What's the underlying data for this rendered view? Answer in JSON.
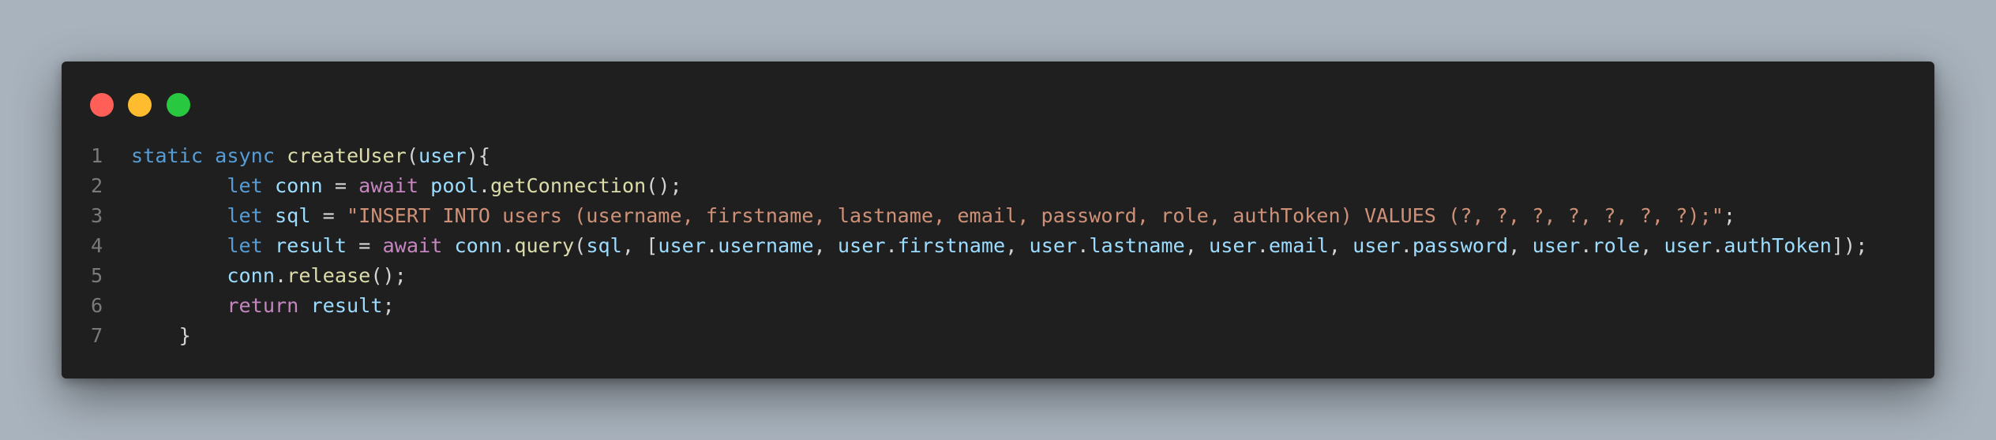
{
  "window": {
    "controls": [
      "close",
      "minimize",
      "maximize"
    ],
    "colors": {
      "close": "#ff5f57",
      "minimize": "#febc2e",
      "maximize": "#28c840"
    }
  },
  "code": {
    "lines": [
      {
        "number": "1",
        "indent": "",
        "tokens": [
          {
            "t": "static",
            "c": "kw-blue"
          },
          {
            "t": " ",
            "c": "punc"
          },
          {
            "t": "async",
            "c": "kw-blue"
          },
          {
            "t": " ",
            "c": "punc"
          },
          {
            "t": "createUser",
            "c": "fn"
          },
          {
            "t": "(",
            "c": "punc"
          },
          {
            "t": "user",
            "c": "var"
          },
          {
            "t": "){",
            "c": "punc"
          }
        ]
      },
      {
        "number": "2",
        "indent": "        ",
        "tokens": [
          {
            "t": "let",
            "c": "kw-blue"
          },
          {
            "t": " ",
            "c": "punc"
          },
          {
            "t": "conn",
            "c": "var"
          },
          {
            "t": " = ",
            "c": "punc"
          },
          {
            "t": "await",
            "c": "kw-pink"
          },
          {
            "t": " ",
            "c": "punc"
          },
          {
            "t": "pool",
            "c": "var"
          },
          {
            "t": ".",
            "c": "punc"
          },
          {
            "t": "getConnection",
            "c": "fn"
          },
          {
            "t": "();",
            "c": "punc"
          }
        ]
      },
      {
        "number": "3",
        "indent": "        ",
        "tokens": [
          {
            "t": "let",
            "c": "kw-blue"
          },
          {
            "t": " ",
            "c": "punc"
          },
          {
            "t": "sql",
            "c": "var"
          },
          {
            "t": " = ",
            "c": "punc"
          },
          {
            "t": "\"INSERT INTO users (username, firstname, lastname, email, password, role, authToken) VALUES (?, ?, ?, ?, ?, ?, ?);\"",
            "c": "str"
          },
          {
            "t": ";",
            "c": "punc"
          }
        ]
      },
      {
        "number": "4",
        "indent": "        ",
        "tokens": [
          {
            "t": "let",
            "c": "kw-blue"
          },
          {
            "t": " ",
            "c": "punc"
          },
          {
            "t": "result",
            "c": "var"
          },
          {
            "t": " = ",
            "c": "punc"
          },
          {
            "t": "await",
            "c": "kw-pink"
          },
          {
            "t": " ",
            "c": "punc"
          },
          {
            "t": "conn",
            "c": "var"
          },
          {
            "t": ".",
            "c": "punc"
          },
          {
            "t": "query",
            "c": "fn"
          },
          {
            "t": "(",
            "c": "punc"
          },
          {
            "t": "sql",
            "c": "var"
          },
          {
            "t": ", [",
            "c": "punc"
          },
          {
            "t": "user",
            "c": "var"
          },
          {
            "t": ".",
            "c": "punc"
          },
          {
            "t": "username",
            "c": "var"
          },
          {
            "t": ", ",
            "c": "punc"
          },
          {
            "t": "user",
            "c": "var"
          },
          {
            "t": ".",
            "c": "punc"
          },
          {
            "t": "firstname",
            "c": "var"
          },
          {
            "t": ", ",
            "c": "punc"
          },
          {
            "t": "user",
            "c": "var"
          },
          {
            "t": ".",
            "c": "punc"
          },
          {
            "t": "lastname",
            "c": "var"
          },
          {
            "t": ", ",
            "c": "punc"
          },
          {
            "t": "user",
            "c": "var"
          },
          {
            "t": ".",
            "c": "punc"
          },
          {
            "t": "email",
            "c": "var"
          },
          {
            "t": ", ",
            "c": "punc"
          },
          {
            "t": "user",
            "c": "var"
          },
          {
            "t": ".",
            "c": "punc"
          },
          {
            "t": "password",
            "c": "var"
          },
          {
            "t": ", ",
            "c": "punc"
          },
          {
            "t": "user",
            "c": "var"
          },
          {
            "t": ".",
            "c": "punc"
          },
          {
            "t": "role",
            "c": "var"
          },
          {
            "t": ", ",
            "c": "punc"
          },
          {
            "t": "user",
            "c": "var"
          },
          {
            "t": ".",
            "c": "punc"
          },
          {
            "t": "authToken",
            "c": "var"
          },
          {
            "t": "]);",
            "c": "punc"
          }
        ]
      },
      {
        "number": "5",
        "indent": "        ",
        "tokens": [
          {
            "t": "conn",
            "c": "var"
          },
          {
            "t": ".",
            "c": "punc"
          },
          {
            "t": "release",
            "c": "fn"
          },
          {
            "t": "();",
            "c": "punc"
          }
        ]
      },
      {
        "number": "6",
        "indent": "        ",
        "tokens": [
          {
            "t": "return",
            "c": "kw-pink"
          },
          {
            "t": " ",
            "c": "punc"
          },
          {
            "t": "result",
            "c": "var"
          },
          {
            "t": ";",
            "c": "punc"
          }
        ]
      },
      {
        "number": "7",
        "indent": "    ",
        "tokens": [
          {
            "t": "}",
            "c": "punc"
          }
        ]
      }
    ]
  }
}
